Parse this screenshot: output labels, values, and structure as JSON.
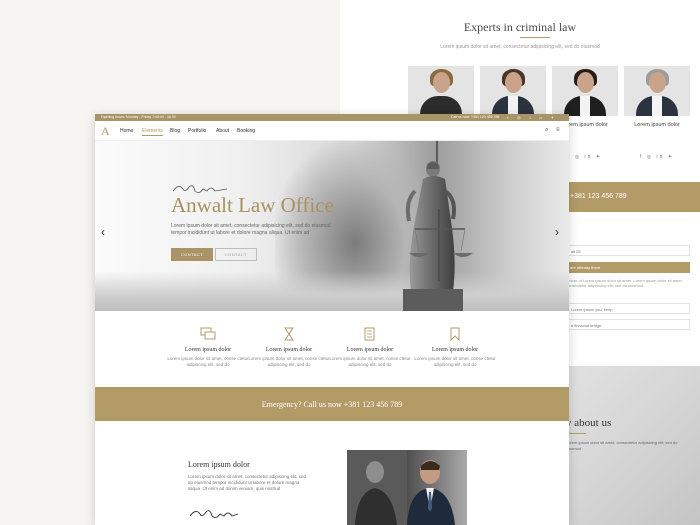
{
  "back_page": {
    "section_title": "Experts in criminal law",
    "section_subtitle": "Lorem ipsum dolor sit amet, consectetur adipisicing elit, sed do eiusmod",
    "team": [
      {
        "name": ""
      },
      {
        "name": ""
      },
      {
        "name": "Lorem ipsum dolor"
      },
      {
        "name": "Lorem ipsum dolor"
      }
    ],
    "team_social_icons": [
      "facebook-icon",
      "instagram-icon",
      "linkedin-icon",
      "twitter-icon"
    ],
    "emergency_phone": "+381 123 456 789",
    "form": {
      "field_email": "ail 05",
      "button_label": "are already there",
      "body_text": "umber of Lorem ipsum dolor sit amet. Lorem ipsum dolor sit amet, consectetur adipisicing elit, sed do eiusmod",
      "field_keep": "Lorem ipsum you, keep",
      "field_bridge": "e financial bridge"
    },
    "why_title": "y about us",
    "why_text": "Lorem ipsum dolor sit amet, consectetur adipisicing elit, sed do eiusmod"
  },
  "front_page": {
    "topbar": {
      "hours": "Opening hours: Monday - Friday 7:00:00 - 18:00",
      "phone": "Call us now: +381 123 456 789",
      "social_icons": [
        "facebook-icon",
        "instagram-icon",
        "linkedin-icon",
        "twitter-icon"
      ]
    },
    "nav": {
      "logo": "A",
      "items": [
        "Home",
        "Elements",
        "Blog",
        "Portfolio",
        "About",
        "Booking"
      ],
      "active": "Elements"
    },
    "hero": {
      "title": "Anwalt Law Office",
      "text": "Lorem ipsum dolor sit amet, consectetur adipisicing elit, sed do eiusmod tempor incididunt ut labore et dolore magna aliqua. Ut enim ad",
      "button_primary": "CONTACT",
      "button_secondary": "CONTACT"
    },
    "features": [
      {
        "icon": "chat-bubbles-icon",
        "title": "Lorem ipsum dolor",
        "text": "Lorem ipsum dolor sit amet, conse ctetur adipiscing elit, sed do"
      },
      {
        "icon": "hourglass-icon",
        "title": "Lorem ipsum dolor",
        "text": "Lorem ipsum dolor sit amet, conse ctetur adipiscing elit, sed do"
      },
      {
        "icon": "documents-icon",
        "title": "Lorem ipsum dolor",
        "text": "Lorem ipsum dolor sit amet, conse ctetur adipiscing elit, sed do"
      },
      {
        "icon": "bookmark-icon",
        "title": "Lorem ipsum dolor",
        "text": "Lorem ipsum dolor sit amet, conse ctetur adipiscing elit, sed do"
      }
    ],
    "emergency": "Emergency? Call us now  +381 123 456 789",
    "about": {
      "title": "Lorem ipsum dolor",
      "text": "Lorem ipsum dolor sit amet, consectetur adipiscing elit, sed do eiusmod tempor incididunt ut labore et dolore magna aliqua. Ut enim ad minim veniam, quis nostrud"
    }
  },
  "colors": {
    "accent_gold": "#b39b68",
    "topbar_gold": "#a89466",
    "page_background": "#f6f5f1"
  }
}
